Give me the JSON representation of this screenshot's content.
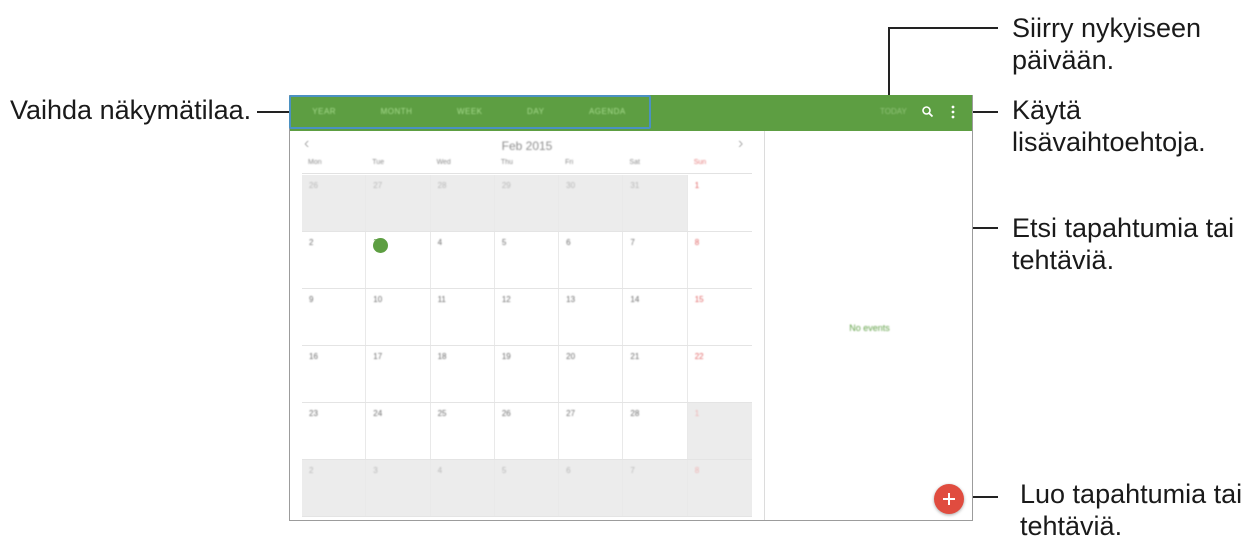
{
  "callouts": {
    "change_view": "Vaihda näkymätilaa.",
    "go_today": "Siirry nykyiseen\npäivään.",
    "more_options": "Käytä\nlisävaihtoehtoja.",
    "search": "Etsi tapahtumia tai\ntehtäviä.",
    "create": "Luo tapahtumia tai\ntehtäviä."
  },
  "app": {
    "view_tabs": [
      "YEAR",
      "MONTH",
      "WEEK",
      "DAY",
      "AGENDA"
    ],
    "today_label": "TODAY",
    "month_title": "Feb 2015",
    "prev": "‹",
    "next": "›",
    "no_events": "No events",
    "accent_color": "#5d9e42",
    "fab_color": "#e04c3f",
    "icons": [
      "search-icon",
      "more-vert-icon",
      "add-icon",
      "chevron-left-icon",
      "chevron-right-icon"
    ]
  },
  "calendar": {
    "weekdays": [
      "Mon",
      "Tue",
      "Wed",
      "Thu",
      "Fri",
      "Sat",
      "Sun"
    ],
    "weeks": [
      [
        {
          "d": "26",
          "o": true
        },
        {
          "d": "27",
          "o": true
        },
        {
          "d": "28",
          "o": true
        },
        {
          "d": "29",
          "o": true
        },
        {
          "d": "30",
          "o": true
        },
        {
          "d": "31",
          "o": true
        },
        {
          "d": "1",
          "o": false
        }
      ],
      [
        {
          "d": "2",
          "o": false
        },
        {
          "d": "3",
          "o": false,
          "today": true
        },
        {
          "d": "4",
          "o": false
        },
        {
          "d": "5",
          "o": false
        },
        {
          "d": "6",
          "o": false
        },
        {
          "d": "7",
          "o": false
        },
        {
          "d": "8",
          "o": false
        }
      ],
      [
        {
          "d": "9",
          "o": false
        },
        {
          "d": "10",
          "o": false
        },
        {
          "d": "11",
          "o": false
        },
        {
          "d": "12",
          "o": false
        },
        {
          "d": "13",
          "o": false
        },
        {
          "d": "14",
          "o": false
        },
        {
          "d": "15",
          "o": false
        }
      ],
      [
        {
          "d": "16",
          "o": false
        },
        {
          "d": "17",
          "o": false
        },
        {
          "d": "18",
          "o": false
        },
        {
          "d": "19",
          "o": false
        },
        {
          "d": "20",
          "o": false
        },
        {
          "d": "21",
          "o": false
        },
        {
          "d": "22",
          "o": false
        }
      ],
      [
        {
          "d": "23",
          "o": false
        },
        {
          "d": "24",
          "o": false
        },
        {
          "d": "25",
          "o": false
        },
        {
          "d": "26",
          "o": false
        },
        {
          "d": "27",
          "o": false
        },
        {
          "d": "28",
          "o": false
        },
        {
          "d": "1",
          "o": true
        }
      ],
      [
        {
          "d": "2",
          "o": true
        },
        {
          "d": "3",
          "o": true
        },
        {
          "d": "4",
          "o": true
        },
        {
          "d": "5",
          "o": true
        },
        {
          "d": "6",
          "o": true
        },
        {
          "d": "7",
          "o": true
        },
        {
          "d": "8",
          "o": true
        }
      ]
    ]
  }
}
